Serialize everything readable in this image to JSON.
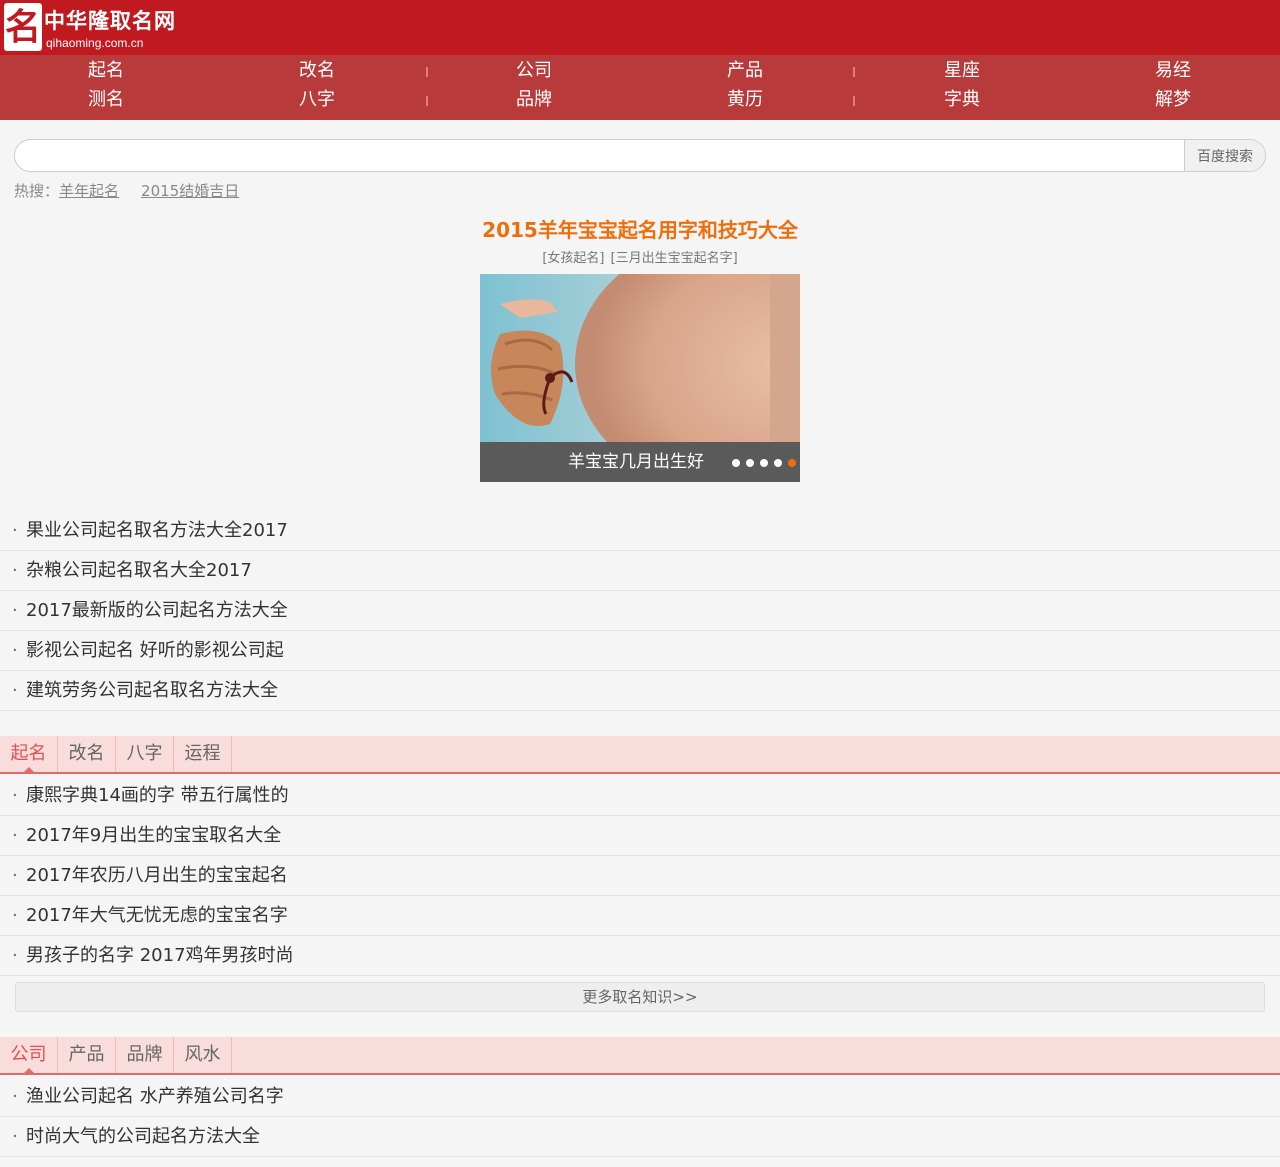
{
  "logo": {
    "mark": "名",
    "title": "中华隆取名网",
    "domain": "qihaoming.com.cn"
  },
  "nav": {
    "items": [
      "起名",
      "改名",
      "测名",
      "八字",
      "公司",
      "产品",
      "品牌",
      "黄历",
      "星座",
      "易经",
      "字典",
      "解梦"
    ]
  },
  "search": {
    "placeholder": "",
    "button": "百度搜索"
  },
  "hot": {
    "label": "热搜：",
    "links": [
      "羊年起名",
      "2015结婚吉日"
    ]
  },
  "feature": {
    "title": "2015羊年宝宝起名用字和技巧大全",
    "tags": [
      "[女孩起名]",
      "[三月出生宝宝起名字]"
    ],
    "slide_caption": "羊宝宝几月出生好",
    "dots_total": 5,
    "active_dot": 5
  },
  "company_list": [
    "果业公司起名取名方法大全2017",
    "杂粮公司起名取名大全2017",
    "2017最新版的公司起名方法大全",
    "影视公司起名 好听的影视公司起",
    "建筑劳务公司起名取名方法大全"
  ],
  "tabs1": {
    "labels": [
      "起名",
      "改名",
      "八字",
      "运程"
    ],
    "active": 0,
    "items": [
      "康熙字典14画的字 带五行属性的",
      "2017年9月出生的宝宝取名大全",
      "2017年农历八月出生的宝宝起名",
      "2017年大气无忧无虑的宝宝名字",
      "男孩子的名字 2017鸡年男孩时尚"
    ],
    "more": "更多取名知识>>"
  },
  "tabs2": {
    "labels": [
      "公司",
      "产品",
      "品牌",
      "风水"
    ],
    "active": 0,
    "items": [
      "渔业公司起名 水产养殖公司名字",
      "时尚大气的公司起名方法大全"
    ]
  },
  "colors": {
    "header": "#c11920",
    "nav": "#b83a3b",
    "feature_title": "#f06d0b",
    "tab_active": "#e0524f",
    "tab_bar": "#f9dcdc"
  }
}
